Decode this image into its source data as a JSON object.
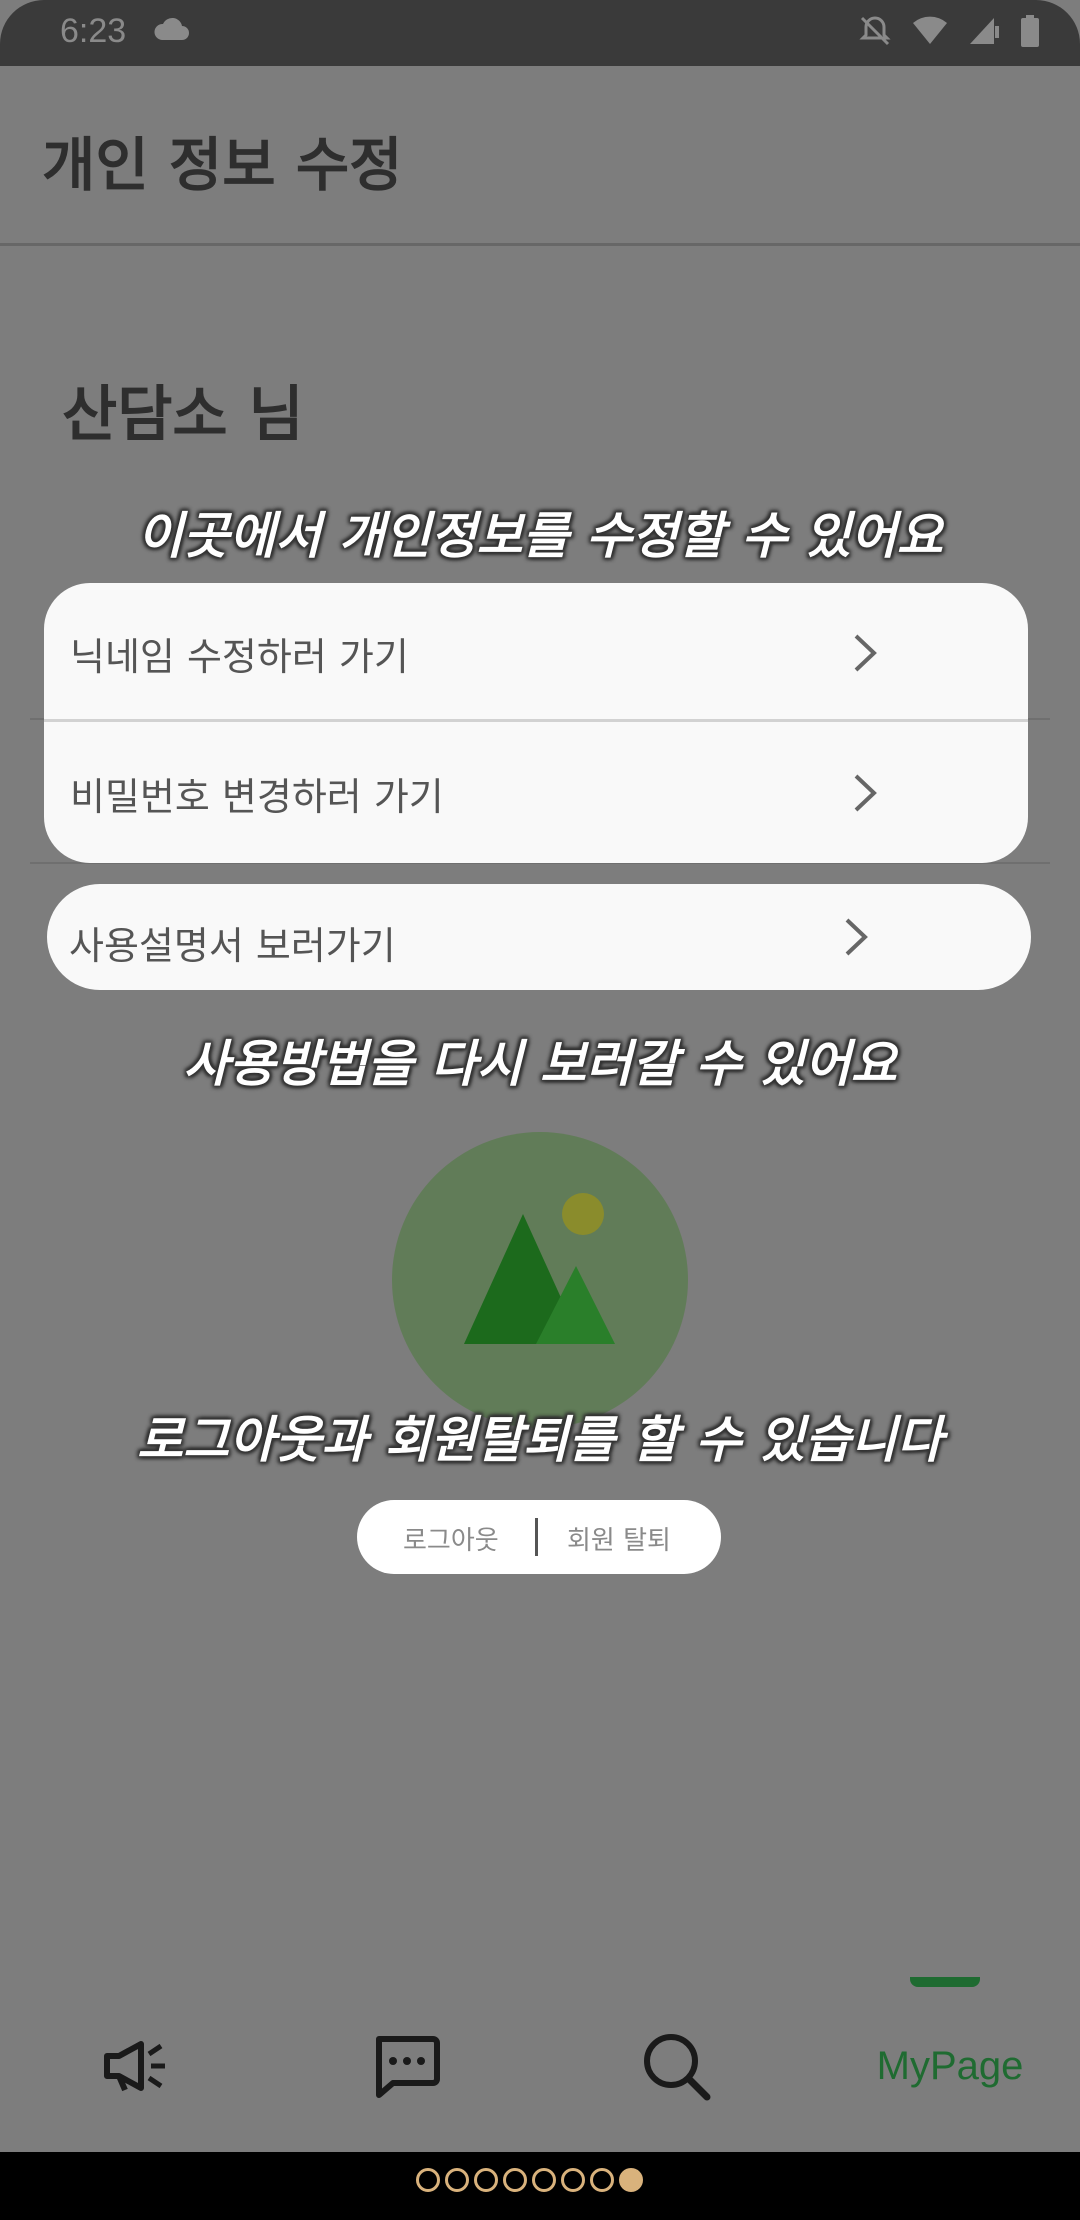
{
  "status_bar": {
    "time": "6:23"
  },
  "header": {
    "title": "개인 정보 수정"
  },
  "user": {
    "name": "산담소 님"
  },
  "hints": {
    "edit_info": "이곳에서 개인정보를 수정할 수 있어요",
    "manual": "사용방법을 다시 보러갈 수 있어요",
    "account": "로그아웃과 회원탈퇴를 할 수 있습니다"
  },
  "menu": {
    "nickname": "닉네임 수정하러 가기",
    "password": "비밀번호 변경하러 가기",
    "manual": "사용설명서 보러가기"
  },
  "account": {
    "logout": "로그아웃",
    "withdraw": "회원 탈퇴"
  },
  "nav": {
    "items": [
      {
        "icon": "megaphone-icon"
      },
      {
        "icon": "chat-icon"
      },
      {
        "icon": "search-icon"
      },
      {
        "label": "MyPage"
      }
    ],
    "active": "MyPage"
  },
  "colors": {
    "accent": "#1f6b31",
    "overlay_bg": "#7d7d7d",
    "card_bg": "#f9f9f9",
    "page_indicator": "#d9b27c"
  },
  "page_indicator": {
    "total": 8,
    "current": 8
  }
}
